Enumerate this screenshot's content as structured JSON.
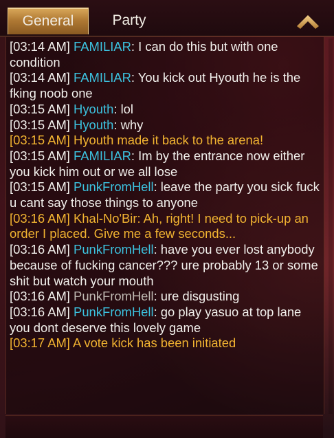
{
  "tabs": {
    "general": "General",
    "party": "Party"
  },
  "icons": {
    "collapse": "chevron-up-icon"
  },
  "colors": {
    "player_name": "#3cc2df",
    "system_text": "#f2b431",
    "chat_text": "#f2f0ec",
    "muted_name": "#bfb9b2",
    "tab_active": "#c08a40"
  },
  "messages": [
    {
      "time": "[03:14 AM]",
      "name": "FAMILIAR",
      "text": " I can do this but with one condition",
      "kind": "player"
    },
    {
      "time": "[03:14 AM]",
      "name": "FAMILIAR",
      "text": " You kick out Hyouth he is the fking noob one",
      "kind": "player"
    },
    {
      "time": "[03:15 AM]",
      "name": "Hyouth",
      "text": " lol",
      "kind": "player"
    },
    {
      "time": "[03:15 AM]",
      "name": "Hyouth",
      "text": " why",
      "kind": "player"
    },
    {
      "time": "[03:15 AM]",
      "text": " Hyouth made it back to the arena!",
      "kind": "system"
    },
    {
      "time": "[03:15 AM]",
      "name": "FAMILIAR",
      "text": " Im by the entrance now either you kick him out or we all lose",
      "kind": "player"
    },
    {
      "time": "[03:15 AM]",
      "name": "PunkFromHell",
      "text": " leave the party you sick fuck u cant say those things to anyone",
      "kind": "player"
    },
    {
      "time": "[03:16 AM]",
      "text": " Khal-No'Bir: Ah, right! I need to pick-up an order I placed. Give me a few seconds...",
      "kind": "system"
    },
    {
      "time": "[03:16 AM]",
      "name": "PunkFromHell",
      "text": " have you ever lost anybody because of fucking cancer??? ure probably 13 or some shit but watch your mouth",
      "kind": "player"
    },
    {
      "time": "[03:16 AM]",
      "name": "PunkFromHell",
      "text": " ure disgusting",
      "kind": "muted"
    },
    {
      "time": "[03:16 AM]",
      "name": "PunkFromHell",
      "text": " go play yasuo at top lane you dont deserve this lovely game",
      "kind": "player"
    },
    {
      "time": "[03:17 AM]",
      "text": " A vote kick has been initiated",
      "kind": "system"
    }
  ]
}
